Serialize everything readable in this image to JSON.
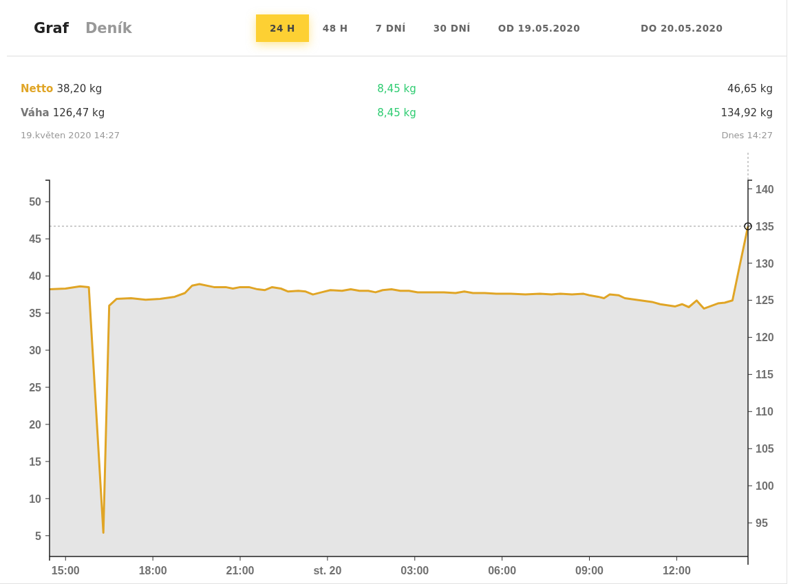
{
  "tabs": [
    {
      "label": "Graf",
      "selected": true
    },
    {
      "label": "Deník",
      "selected": false
    }
  ],
  "ranges": [
    {
      "label": "24 H",
      "selected": true
    },
    {
      "label": "48 H",
      "selected": false
    },
    {
      "label": "7 DNÍ",
      "selected": false
    },
    {
      "label": "30 DNÍ",
      "selected": false
    },
    {
      "label": "OD 19.05.2020",
      "selected": false
    },
    {
      "label": "DO 20.05.2020",
      "selected": false
    }
  ],
  "stats": [
    {
      "kind": "netto",
      "label": "Netto",
      "start": "38,20 kg",
      "change": "8,45 kg",
      "end": "46,65 kg"
    },
    {
      "kind": "weight",
      "label": "Váha",
      "start": "126,47 kg",
      "change": "8,45 kg",
      "end": "134,92 kg"
    }
  ],
  "start_time": "19.květen 2020 14:27",
  "end_time": "Dnes 14:27",
  "chart": {
    "chart_data": {
      "type": "area",
      "x": [
        "2020-05-19T14:27",
        "2020-05-19T15:00",
        "2020-05-19T15:30",
        "2020-05-19T15:48",
        "2020-05-19T16:18",
        "2020-05-19T16:30",
        "2020-05-19T16:45",
        "2020-05-19T17:15",
        "2020-05-19T17:45",
        "2020-05-19T18:15",
        "2020-05-19T18:45",
        "2020-05-19T19:06",
        "2020-05-19T19:21",
        "2020-05-19T19:36",
        "2020-05-19T20:06",
        "2020-05-19T20:30",
        "2020-05-19T20:45",
        "2020-05-19T21:00",
        "2020-05-19T21:18",
        "2020-05-19T21:36",
        "2020-05-19T21:51",
        "2020-05-19T22:06",
        "2020-05-19T22:24",
        "2020-05-19T22:39",
        "2020-05-19T23:00",
        "2020-05-19T23:15",
        "2020-05-19T23:30",
        "2020-05-19T23:48",
        "2020-05-20T00:06",
        "2020-05-20T00:30",
        "2020-05-20T00:48",
        "2020-05-20T01:06",
        "2020-05-20T01:24",
        "2020-05-20T01:39",
        "2020-05-20T01:54",
        "2020-05-20T02:12",
        "2020-05-20T02:30",
        "2020-05-20T02:48",
        "2020-05-20T03:06",
        "2020-05-20T03:30",
        "2020-05-20T04:00",
        "2020-05-20T04:24",
        "2020-05-20T04:42",
        "2020-05-20T05:00",
        "2020-05-20T05:24",
        "2020-05-20T05:48",
        "2020-05-20T06:18",
        "2020-05-20T06:48",
        "2020-05-20T07:18",
        "2020-05-20T07:42",
        "2020-05-20T08:00",
        "2020-05-20T08:24",
        "2020-05-20T08:48",
        "2020-05-20T09:00",
        "2020-05-20T09:18",
        "2020-05-20T09:30",
        "2020-05-20T09:42",
        "2020-05-20T10:00",
        "2020-05-20T10:13",
        "2020-05-20T11:09",
        "2020-05-20T11:26",
        "2020-05-20T11:57",
        "2020-05-20T12:11",
        "2020-05-20T12:25",
        "2020-05-20T12:41",
        "2020-05-20T12:56",
        "2020-05-20T13:25",
        "2020-05-20T13:39",
        "2020-05-20T13:55",
        "2020-05-20T14:08",
        "2020-05-20T14:27"
      ],
      "series": [
        {
          "color": "#e0a526",
          "values": [
            38.2,
            38.3,
            38.6,
            38.5,
            5.4,
            36.0,
            36.9,
            37.0,
            36.8,
            36.9,
            37.2,
            37.7,
            38.7,
            38.9,
            38.5,
            38.5,
            38.3,
            38.5,
            38.5,
            38.2,
            38.1,
            38.5,
            38.3,
            37.9,
            38.0,
            37.9,
            37.5,
            37.8,
            38.1,
            38.0,
            38.2,
            38.0,
            38.0,
            37.8,
            38.1,
            38.2,
            38.0,
            38.0,
            37.8,
            37.8,
            37.8,
            37.7,
            37.9,
            37.7,
            37.7,
            37.6,
            37.6,
            37.5,
            37.6,
            37.5,
            37.6,
            37.5,
            37.6,
            37.4,
            37.2,
            37.0,
            37.5,
            37.4,
            37.0,
            36.5,
            36.2,
            35.9,
            36.2,
            35.8,
            36.7,
            35.6,
            36.3,
            36.4,
            36.7,
            40.8,
            46.7
          ]
        }
      ],
      "xlim": [
        "2020-05-19T14:27",
        "2020-05-20T14:27"
      ],
      "ylim": [
        2.2,
        52.9
      ],
      "xticks": [
        {
          "value": "2020-05-19T15:00",
          "label": "15:00"
        },
        {
          "value": "2020-05-19T18:00",
          "label": "18:00"
        },
        {
          "value": "2020-05-19T21:00",
          "label": "21:00"
        },
        {
          "value": "2020-05-20T00:00",
          "label": "st. 20"
        },
        {
          "value": "2020-05-20T03:00",
          "label": "03:00"
        },
        {
          "value": "2020-05-20T06:00",
          "label": "06:00"
        },
        {
          "value": "2020-05-20T09:00",
          "label": "09:00"
        },
        {
          "value": "2020-05-20T12:00",
          "label": "12:00"
        }
      ],
      "yticks": [
        5,
        10,
        15,
        20,
        25,
        30,
        35,
        40,
        45,
        50
      ],
      "ref_lines": [
        {
          "axis": "y",
          "value": 46.7
        },
        {
          "axis": "x",
          "value": "2020-05-20T14:27"
        }
      ]
    },
    "right_axis": {
      "ticks": [
        "140",
        "135",
        "130",
        "125",
        "120",
        "115",
        "110",
        "105",
        "100",
        "95"
      ]
    }
  }
}
